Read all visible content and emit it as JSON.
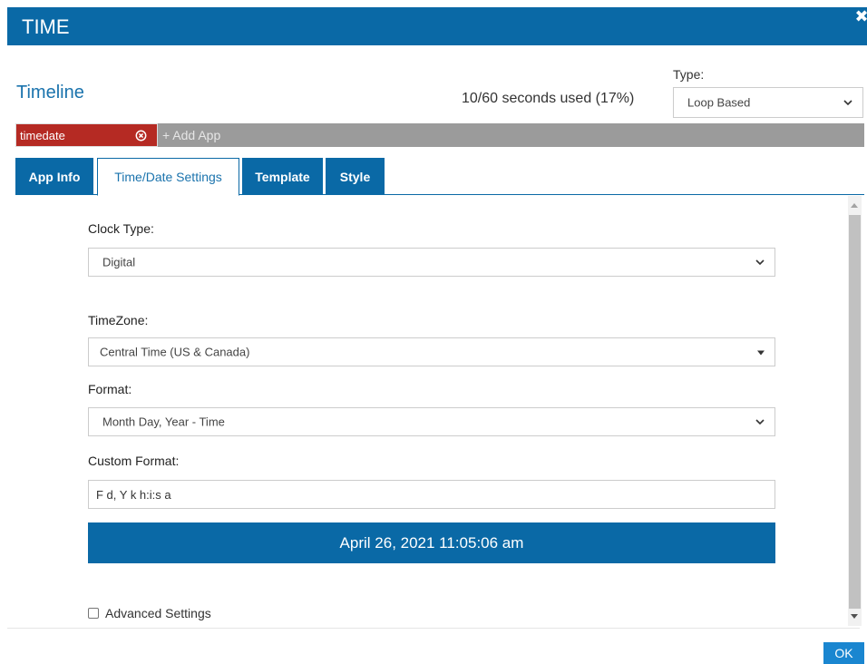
{
  "dialog": {
    "title": "TIME",
    "close_icon": "close-icon"
  },
  "header": {
    "timeline_title": "Timeline",
    "seconds_used": "10/60 seconds used (17%)",
    "type_label": "Type:",
    "type_value": "Loop Based"
  },
  "apps": {
    "items": [
      {
        "label": "timedate",
        "color": "#b52a23"
      }
    ],
    "add_label": "+ Add App"
  },
  "tabs": [
    {
      "label": "App Info",
      "active": false
    },
    {
      "label": "Time/Date Settings",
      "active": true
    },
    {
      "label": "Template",
      "active": false
    },
    {
      "label": "Style",
      "active": false
    }
  ],
  "form": {
    "clock_type": {
      "label": "Clock Type:",
      "value": "Digital"
    },
    "timezone": {
      "label": "TimeZone:",
      "value": "Central Time (US & Canada)"
    },
    "format": {
      "label": "Format:",
      "value": "Month Day, Year - Time"
    },
    "custom_format": {
      "label": "Custom Format:",
      "value": "F d, Y k h:i:s a"
    },
    "preview": "April 26, 2021 11:05:06 am",
    "advanced": {
      "label": "Advanced Settings",
      "checked": false
    }
  },
  "footer": {
    "ok_label": "OK"
  },
  "colors": {
    "primary": "#0a69a6",
    "chip": "#b52a23",
    "ok": "#1a86d0"
  }
}
